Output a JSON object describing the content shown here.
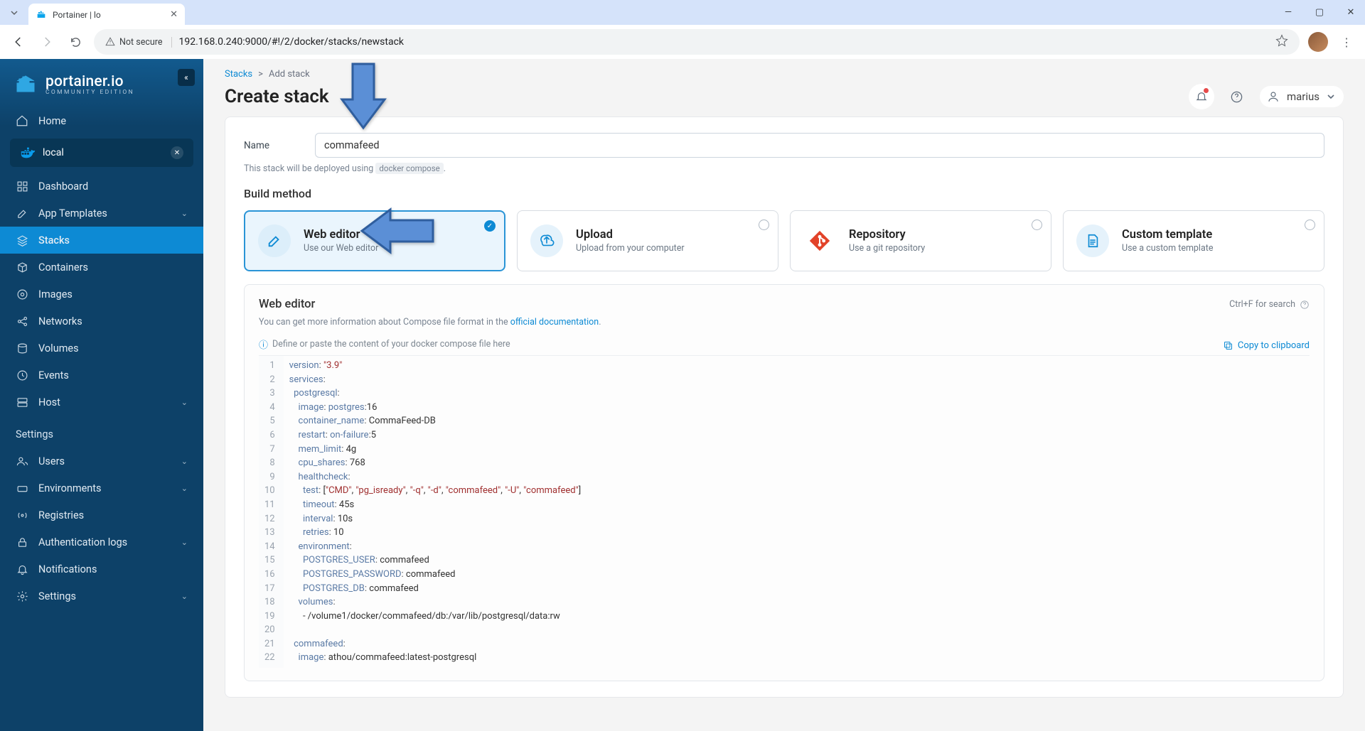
{
  "browser": {
    "tab_title": "Portainer | lo",
    "url_security": "Not secure",
    "url": "192.168.0.240:9000/#!/2/docker/stacks/newstack"
  },
  "logo": {
    "name": "portainer.io",
    "edition": "COMMUNITY EDITION"
  },
  "nav": {
    "home": "Home",
    "env_label": "local",
    "items": {
      "dashboard": "Dashboard",
      "app_templates": "App Templates",
      "stacks": "Stacks",
      "containers": "Containers",
      "images": "Images",
      "networks": "Networks",
      "volumes": "Volumes",
      "events": "Events",
      "host": "Host"
    },
    "settings_header": "Settings",
    "settings": {
      "users": "Users",
      "environments": "Environments",
      "registries": "Registries",
      "auth_logs": "Authentication logs",
      "notifications": "Notifications",
      "settings": "Settings"
    }
  },
  "breadcrumb": {
    "root": "Stacks",
    "current": "Add stack"
  },
  "page_title": "Create stack",
  "user": {
    "name": "marius"
  },
  "form": {
    "name_label": "Name",
    "name_value": "commafeed",
    "deploy_hint_pre": "This stack will be deployed using ",
    "deploy_hint_code": "docker compose",
    "deploy_hint_post": ".",
    "build_method_label": "Build method"
  },
  "methods": {
    "web": {
      "title": "Web editor",
      "sub": "Use our Web editor"
    },
    "upload": {
      "title": "Upload",
      "sub": "Upload from your computer"
    },
    "repo": {
      "title": "Repository",
      "sub": "Use a git repository"
    },
    "custom": {
      "title": "Custom template",
      "sub": "Use a custom template"
    }
  },
  "editor": {
    "title": "Web editor",
    "search_hint": "Ctrl+F for search",
    "info_pre": "You can get more information about Compose file format in the ",
    "info_link": "official documentation",
    "info_post": ".",
    "paste_hint": "Define or paste the content of your docker compose file here",
    "copy": "Copy to clipboard"
  },
  "code": {
    "lines": [
      {
        "n": 1,
        "t": "version: \"3.9\""
      },
      {
        "n": 2,
        "t": "services:"
      },
      {
        "n": 3,
        "t": "  postgresql:"
      },
      {
        "n": 4,
        "t": "    image: postgres:16"
      },
      {
        "n": 5,
        "t": "    container_name: CommaFeed-DB"
      },
      {
        "n": 6,
        "t": "    restart: on-failure:5"
      },
      {
        "n": 7,
        "t": "    mem_limit: 4g"
      },
      {
        "n": 8,
        "t": "    cpu_shares: 768"
      },
      {
        "n": 9,
        "t": "    healthcheck:"
      },
      {
        "n": 10,
        "t": "      test: [\"CMD\", \"pg_isready\", \"-q\", \"-d\", \"commafeed\", \"-U\", \"commafeed\"]"
      },
      {
        "n": 11,
        "t": "      timeout: 45s"
      },
      {
        "n": 12,
        "t": "      interval: 10s"
      },
      {
        "n": 13,
        "t": "      retries: 10"
      },
      {
        "n": 14,
        "t": "    environment:"
      },
      {
        "n": 15,
        "t": "      POSTGRES_USER: commafeed"
      },
      {
        "n": 16,
        "t": "      POSTGRES_PASSWORD: commafeed"
      },
      {
        "n": 17,
        "t": "      POSTGRES_DB: commafeed"
      },
      {
        "n": 18,
        "t": "    volumes:"
      },
      {
        "n": 19,
        "t": "      - /volume1/docker/commafeed/db:/var/lib/postgresql/data:rw"
      },
      {
        "n": 20,
        "t": ""
      },
      {
        "n": 21,
        "t": "  commafeed:"
      },
      {
        "n": 22,
        "t": "    image: athou/commafeed:latest-postgresql"
      }
    ]
  }
}
